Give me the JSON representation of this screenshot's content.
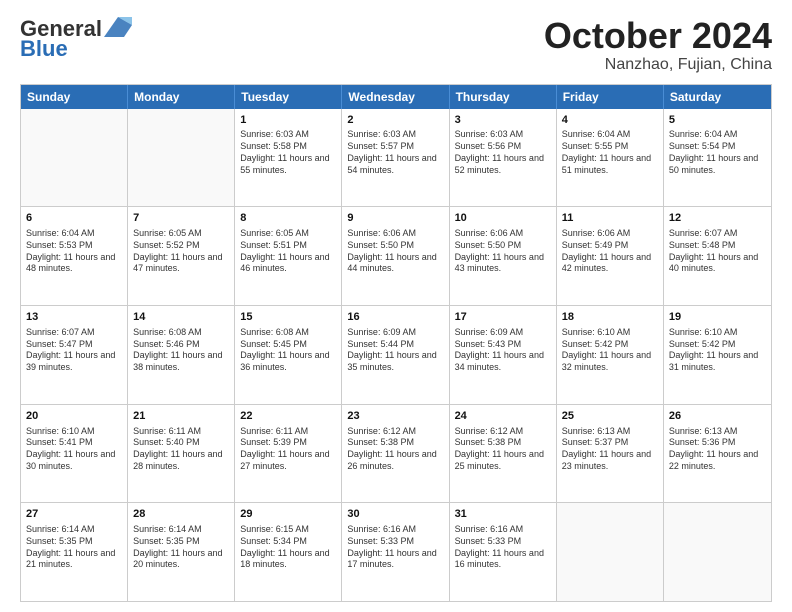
{
  "header": {
    "logo_general": "General",
    "logo_blue": "Blue",
    "month": "October 2024",
    "location": "Nanzhao, Fujian, China"
  },
  "days_of_week": [
    "Sunday",
    "Monday",
    "Tuesday",
    "Wednesday",
    "Thursday",
    "Friday",
    "Saturday"
  ],
  "weeks": [
    [
      {
        "day": "",
        "empty": true
      },
      {
        "day": "",
        "empty": true
      },
      {
        "day": "1",
        "sunrise": "Sunrise: 6:03 AM",
        "sunset": "Sunset: 5:58 PM",
        "daylight": "Daylight: 11 hours and 55 minutes."
      },
      {
        "day": "2",
        "sunrise": "Sunrise: 6:03 AM",
        "sunset": "Sunset: 5:57 PM",
        "daylight": "Daylight: 11 hours and 54 minutes."
      },
      {
        "day": "3",
        "sunrise": "Sunrise: 6:03 AM",
        "sunset": "Sunset: 5:56 PM",
        "daylight": "Daylight: 11 hours and 52 minutes."
      },
      {
        "day": "4",
        "sunrise": "Sunrise: 6:04 AM",
        "sunset": "Sunset: 5:55 PM",
        "daylight": "Daylight: 11 hours and 51 minutes."
      },
      {
        "day": "5",
        "sunrise": "Sunrise: 6:04 AM",
        "sunset": "Sunset: 5:54 PM",
        "daylight": "Daylight: 11 hours and 50 minutes."
      }
    ],
    [
      {
        "day": "6",
        "sunrise": "Sunrise: 6:04 AM",
        "sunset": "Sunset: 5:53 PM",
        "daylight": "Daylight: 11 hours and 48 minutes."
      },
      {
        "day": "7",
        "sunrise": "Sunrise: 6:05 AM",
        "sunset": "Sunset: 5:52 PM",
        "daylight": "Daylight: 11 hours and 47 minutes."
      },
      {
        "day": "8",
        "sunrise": "Sunrise: 6:05 AM",
        "sunset": "Sunset: 5:51 PM",
        "daylight": "Daylight: 11 hours and 46 minutes."
      },
      {
        "day": "9",
        "sunrise": "Sunrise: 6:06 AM",
        "sunset": "Sunset: 5:50 PM",
        "daylight": "Daylight: 11 hours and 44 minutes."
      },
      {
        "day": "10",
        "sunrise": "Sunrise: 6:06 AM",
        "sunset": "Sunset: 5:50 PM",
        "daylight": "Daylight: 11 hours and 43 minutes."
      },
      {
        "day": "11",
        "sunrise": "Sunrise: 6:06 AM",
        "sunset": "Sunset: 5:49 PM",
        "daylight": "Daylight: 11 hours and 42 minutes."
      },
      {
        "day": "12",
        "sunrise": "Sunrise: 6:07 AM",
        "sunset": "Sunset: 5:48 PM",
        "daylight": "Daylight: 11 hours and 40 minutes."
      }
    ],
    [
      {
        "day": "13",
        "sunrise": "Sunrise: 6:07 AM",
        "sunset": "Sunset: 5:47 PM",
        "daylight": "Daylight: 11 hours and 39 minutes."
      },
      {
        "day": "14",
        "sunrise": "Sunrise: 6:08 AM",
        "sunset": "Sunset: 5:46 PM",
        "daylight": "Daylight: 11 hours and 38 minutes."
      },
      {
        "day": "15",
        "sunrise": "Sunrise: 6:08 AM",
        "sunset": "Sunset: 5:45 PM",
        "daylight": "Daylight: 11 hours and 36 minutes."
      },
      {
        "day": "16",
        "sunrise": "Sunrise: 6:09 AM",
        "sunset": "Sunset: 5:44 PM",
        "daylight": "Daylight: 11 hours and 35 minutes."
      },
      {
        "day": "17",
        "sunrise": "Sunrise: 6:09 AM",
        "sunset": "Sunset: 5:43 PM",
        "daylight": "Daylight: 11 hours and 34 minutes."
      },
      {
        "day": "18",
        "sunrise": "Sunrise: 6:10 AM",
        "sunset": "Sunset: 5:42 PM",
        "daylight": "Daylight: 11 hours and 32 minutes."
      },
      {
        "day": "19",
        "sunrise": "Sunrise: 6:10 AM",
        "sunset": "Sunset: 5:42 PM",
        "daylight": "Daylight: 11 hours and 31 minutes."
      }
    ],
    [
      {
        "day": "20",
        "sunrise": "Sunrise: 6:10 AM",
        "sunset": "Sunset: 5:41 PM",
        "daylight": "Daylight: 11 hours and 30 minutes."
      },
      {
        "day": "21",
        "sunrise": "Sunrise: 6:11 AM",
        "sunset": "Sunset: 5:40 PM",
        "daylight": "Daylight: 11 hours and 28 minutes."
      },
      {
        "day": "22",
        "sunrise": "Sunrise: 6:11 AM",
        "sunset": "Sunset: 5:39 PM",
        "daylight": "Daylight: 11 hours and 27 minutes."
      },
      {
        "day": "23",
        "sunrise": "Sunrise: 6:12 AM",
        "sunset": "Sunset: 5:38 PM",
        "daylight": "Daylight: 11 hours and 26 minutes."
      },
      {
        "day": "24",
        "sunrise": "Sunrise: 6:12 AM",
        "sunset": "Sunset: 5:38 PM",
        "daylight": "Daylight: 11 hours and 25 minutes."
      },
      {
        "day": "25",
        "sunrise": "Sunrise: 6:13 AM",
        "sunset": "Sunset: 5:37 PM",
        "daylight": "Daylight: 11 hours and 23 minutes."
      },
      {
        "day": "26",
        "sunrise": "Sunrise: 6:13 AM",
        "sunset": "Sunset: 5:36 PM",
        "daylight": "Daylight: 11 hours and 22 minutes."
      }
    ],
    [
      {
        "day": "27",
        "sunrise": "Sunrise: 6:14 AM",
        "sunset": "Sunset: 5:35 PM",
        "daylight": "Daylight: 11 hours and 21 minutes."
      },
      {
        "day": "28",
        "sunrise": "Sunrise: 6:14 AM",
        "sunset": "Sunset: 5:35 PM",
        "daylight": "Daylight: 11 hours and 20 minutes."
      },
      {
        "day": "29",
        "sunrise": "Sunrise: 6:15 AM",
        "sunset": "Sunset: 5:34 PM",
        "daylight": "Daylight: 11 hours and 18 minutes."
      },
      {
        "day": "30",
        "sunrise": "Sunrise: 6:16 AM",
        "sunset": "Sunset: 5:33 PM",
        "daylight": "Daylight: 11 hours and 17 minutes."
      },
      {
        "day": "31",
        "sunrise": "Sunrise: 6:16 AM",
        "sunset": "Sunset: 5:33 PM",
        "daylight": "Daylight: 11 hours and 16 minutes."
      },
      {
        "day": "",
        "empty": true
      },
      {
        "day": "",
        "empty": true
      }
    ]
  ]
}
